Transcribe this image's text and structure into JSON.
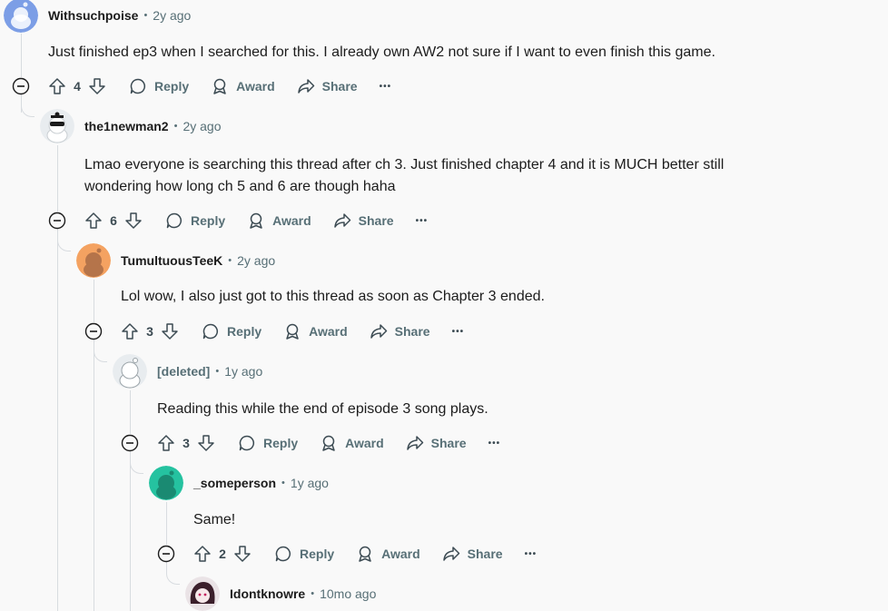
{
  "comments": [
    {
      "author": "Withsuchpoise",
      "time": "2y ago",
      "body": "Just finished ep3 when I searched for this. I already own AW2 not sure if I want to even finish this game.",
      "score": "4",
      "avatar_color": "#7c9ee6",
      "deleted": false
    },
    {
      "author": "the1newman2",
      "time": "2y ago",
      "body": "Lmao everyone is searching this thread after ch 3. Just finished chapter 4 and it is MUCH better still wondering how long ch 5 and 6 are though haha",
      "score": "6",
      "avatar_color": "#e8ecef",
      "deleted": false
    },
    {
      "author": "TumultuousTeeK",
      "time": "2y ago",
      "body": "Lol wow, I also just got to this thread as soon as Chapter 3 ended.",
      "score": "3",
      "avatar_color": "#f4a261",
      "deleted": false
    },
    {
      "author": "[deleted]",
      "time": "1y ago",
      "body": "Reading this while the end of episode 3 song plays.",
      "score": "3",
      "avatar_color": "#e8ecef",
      "deleted": true
    },
    {
      "author": "_someperson",
      "time": "1y ago",
      "body": "Same!",
      "score": "2",
      "avatar_color": "#25c2a0",
      "deleted": false
    },
    {
      "author": "Idontknowre",
      "time": "10mo ago",
      "avatar_color": "#3b1f2b",
      "deleted": false
    }
  ],
  "actions": {
    "reply": "Reply",
    "award": "Award",
    "share": "Share",
    "more": "•••"
  },
  "separator": "•"
}
